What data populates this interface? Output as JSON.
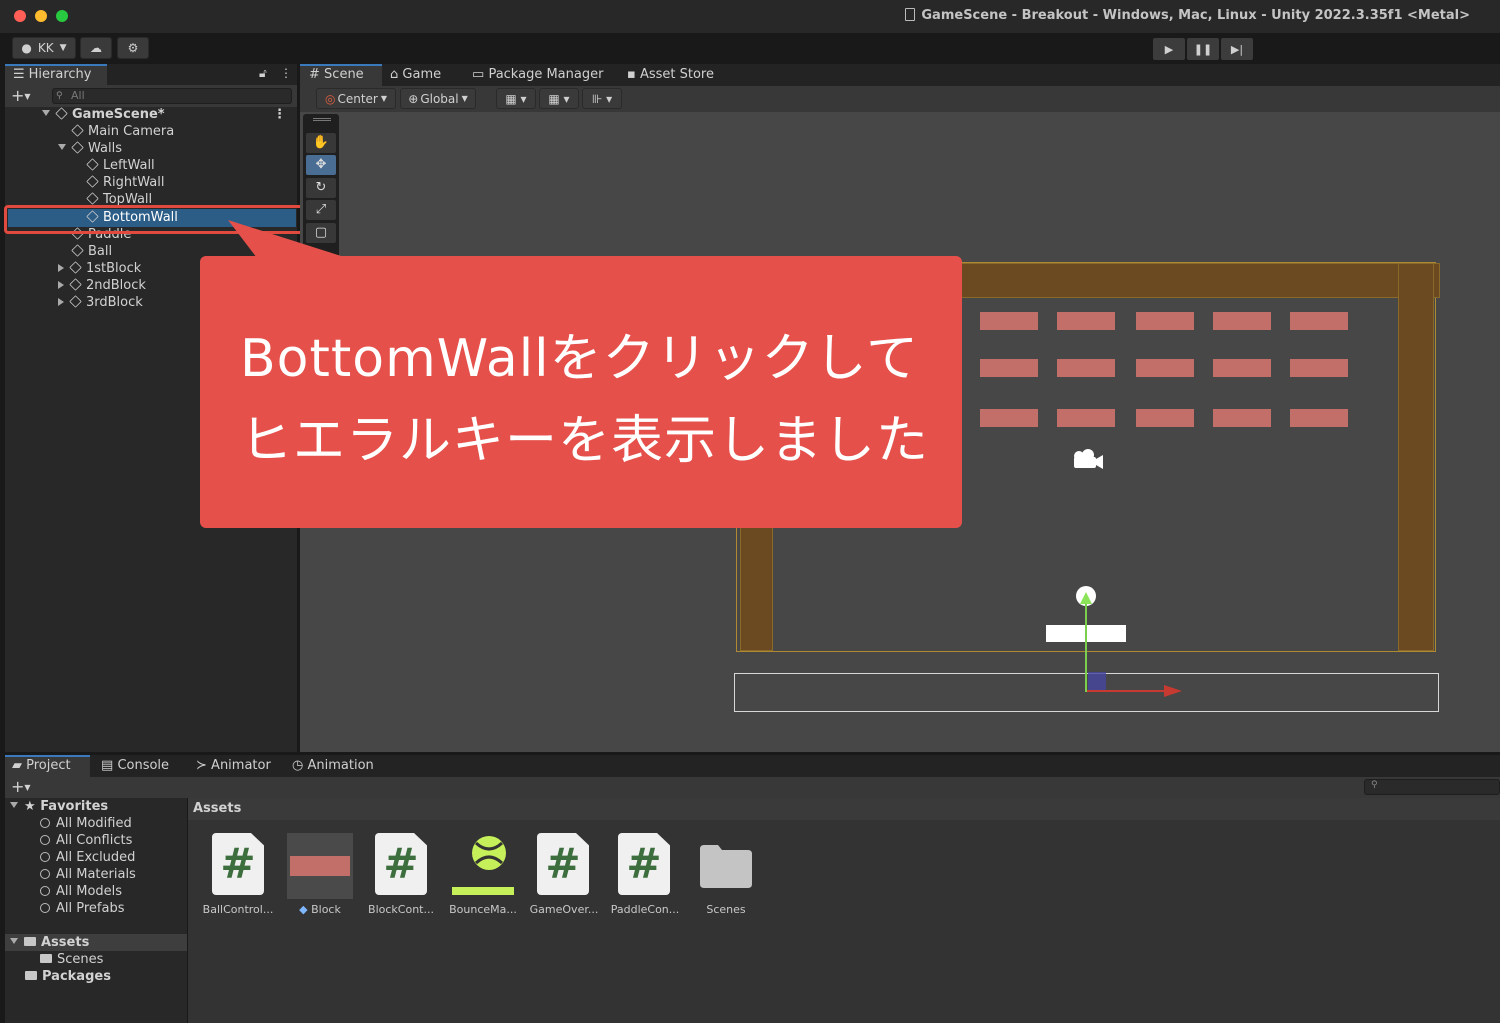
{
  "window": {
    "title": "GameScene - Breakout - Windows, Mac, Linux - Unity 2022.3.35f1 <Metal>"
  },
  "toolbar": {
    "account": "KK"
  },
  "hierarchy": {
    "tab": "Hierarchy",
    "search_placeholder": "All",
    "scene": "GameScene*",
    "items": [
      "Main Camera",
      "Walls",
      "LeftWall",
      "RightWall",
      "TopWall",
      "BottomWall",
      "Paddle",
      "Ball",
      "1stBlock",
      "2ndBlock",
      "3rdBlock"
    ]
  },
  "scene_tabs": [
    "Scene",
    "Game",
    "Package Manager",
    "Asset Store"
  ],
  "scene_toolbar": {
    "pivot": "Center",
    "space": "Global"
  },
  "callout": {
    "line1": "BottomWallをクリックして",
    "line2": "ヒエラルキーを表示しました"
  },
  "bottom_tabs": [
    "Project",
    "Console",
    "Animator",
    "Animation"
  ],
  "project": {
    "favorites_label": "Favorites",
    "favorites": [
      "All Modified",
      "All Conflicts",
      "All Excluded",
      "All Materials",
      "All Models",
      "All Prefabs"
    ],
    "assets_label": "Assets",
    "assets_children": [
      "Scenes"
    ],
    "packages_label": "Packages",
    "assets_header": "Assets",
    "asset_items": [
      "BallControl...",
      "Block",
      "BlockCont...",
      "BounceMa...",
      "GameOver...",
      "PaddleCon...",
      "Scenes"
    ]
  },
  "colors": {
    "selection": "#2c5d87",
    "highlight_box": "#e04a3f",
    "callout": "#e5504a",
    "wall": "#6c4a21",
    "brick": "#c26f69"
  }
}
